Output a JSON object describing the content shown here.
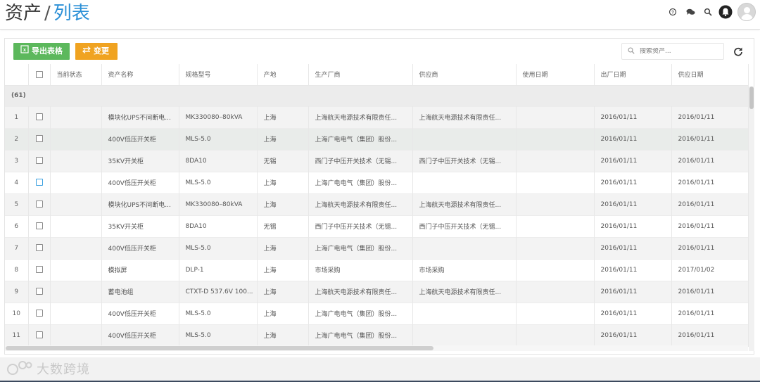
{
  "header": {
    "title_root": "资产",
    "title_sep": "/",
    "title_current": "列表",
    "icons": [
      "help-icon",
      "chat-icon",
      "search-icon",
      "notification-icon",
      "user-avatar"
    ]
  },
  "toolbar": {
    "export_label": "导出表格",
    "change_label": "变更",
    "search_placeholder": "搜索资产..."
  },
  "table": {
    "columns": [
      "当前状态",
      "资产名称",
      "规格型号",
      "产地",
      "生产厂商",
      "供应商",
      "使用日期",
      "出厂日期",
      "供应日期"
    ],
    "group_label": "(61)",
    "rows": [
      {
        "num": "1",
        "status": "",
        "name": "模块化UPS不间断电...",
        "model": "MK330080–80kVA",
        "origin": "上海",
        "maker": "上海航天电源技术有限责任...",
        "supplier": "上海航天电源技术有限责任...",
        "use_date": "",
        "factory_date": "2016/01/11",
        "supply_date": "2016/01/11"
      },
      {
        "num": "2",
        "status": "",
        "name": "400V低压开关柜",
        "model": "MLS-5.0",
        "origin": "上海",
        "maker": "上海广电电气（集团）股份...",
        "supplier": "",
        "use_date": "",
        "factory_date": "2016/01/11",
        "supply_date": "2016/01/11"
      },
      {
        "num": "3",
        "status": "",
        "name": "35KV开关柜",
        "model": "8DA10",
        "origin": "无锡",
        "maker": "西门子中压开关技术（无锡...",
        "supplier": "西门子中压开关技术（无锡...",
        "use_date": "",
        "factory_date": "2016/01/11",
        "supply_date": "2016/01/11"
      },
      {
        "num": "4",
        "status": "",
        "name": "400V低压开关柜",
        "model": "MLS-5.0",
        "origin": "上海",
        "maker": "上海广电电气（集团）股份...",
        "supplier": "",
        "use_date": "",
        "factory_date": "2016/01/11",
        "supply_date": "2016/01/11"
      },
      {
        "num": "5",
        "status": "",
        "name": "模块化UPS不间断电...",
        "model": "MK330080–80kVA",
        "origin": "上海",
        "maker": "上海航天电源技术有限责任...",
        "supplier": "上海航天电源技术有限责任...",
        "use_date": "",
        "factory_date": "2016/01/11",
        "supply_date": "2016/01/11"
      },
      {
        "num": "6",
        "status": "",
        "name": "35KV开关柜",
        "model": "8DA10",
        "origin": "无锡",
        "maker": "西门子中压开关技术（无锡...",
        "supplier": "西门子中压开关技术（无锡...",
        "use_date": "",
        "factory_date": "2016/01/11",
        "supply_date": "2016/01/11"
      },
      {
        "num": "7",
        "status": "",
        "name": "400V低压开关柜",
        "model": "MLS-5.0",
        "origin": "上海",
        "maker": "上海广电电气（集团）股份...",
        "supplier": "",
        "use_date": "",
        "factory_date": "2016/01/11",
        "supply_date": "2016/01/11"
      },
      {
        "num": "8",
        "status": "",
        "name": "模拟屏",
        "model": "DLP-1",
        "origin": "上海",
        "maker": "市场采购",
        "supplier": "市场采购",
        "use_date": "",
        "factory_date": "2016/01/11",
        "supply_date": "2017/01/02"
      },
      {
        "num": "9",
        "status": "",
        "name": "蓄电池组",
        "model": "CTXT-D 537.6V 100...",
        "origin": "上海",
        "maker": "上海航天电源技术有限责任...",
        "supplier": "上海航天电源技术有限责任...",
        "use_date": "",
        "factory_date": "2016/01/11",
        "supply_date": "2016/01/11"
      },
      {
        "num": "10",
        "status": "",
        "name": "400V低压开关柜",
        "model": "MLS-5.0",
        "origin": "上海",
        "maker": "上海广电电气（集团）股份...",
        "supplier": "",
        "use_date": "",
        "factory_date": "2016/01/11",
        "supply_date": "2016/01/11"
      },
      {
        "num": "11",
        "status": "",
        "name": "400V低压开关柜",
        "model": "MLS-5.0",
        "origin": "上海",
        "maker": "上海广电电气（集团）股份...",
        "supplier": "",
        "use_date": "",
        "factory_date": "2016/01/11",
        "supply_date": "2016/01/11"
      }
    ]
  },
  "watermark": {
    "text": "大数跨境"
  },
  "colors": {
    "accent": "#2a8fd6",
    "export_button": "#5cb85c",
    "change_button": "#f0a321"
  }
}
